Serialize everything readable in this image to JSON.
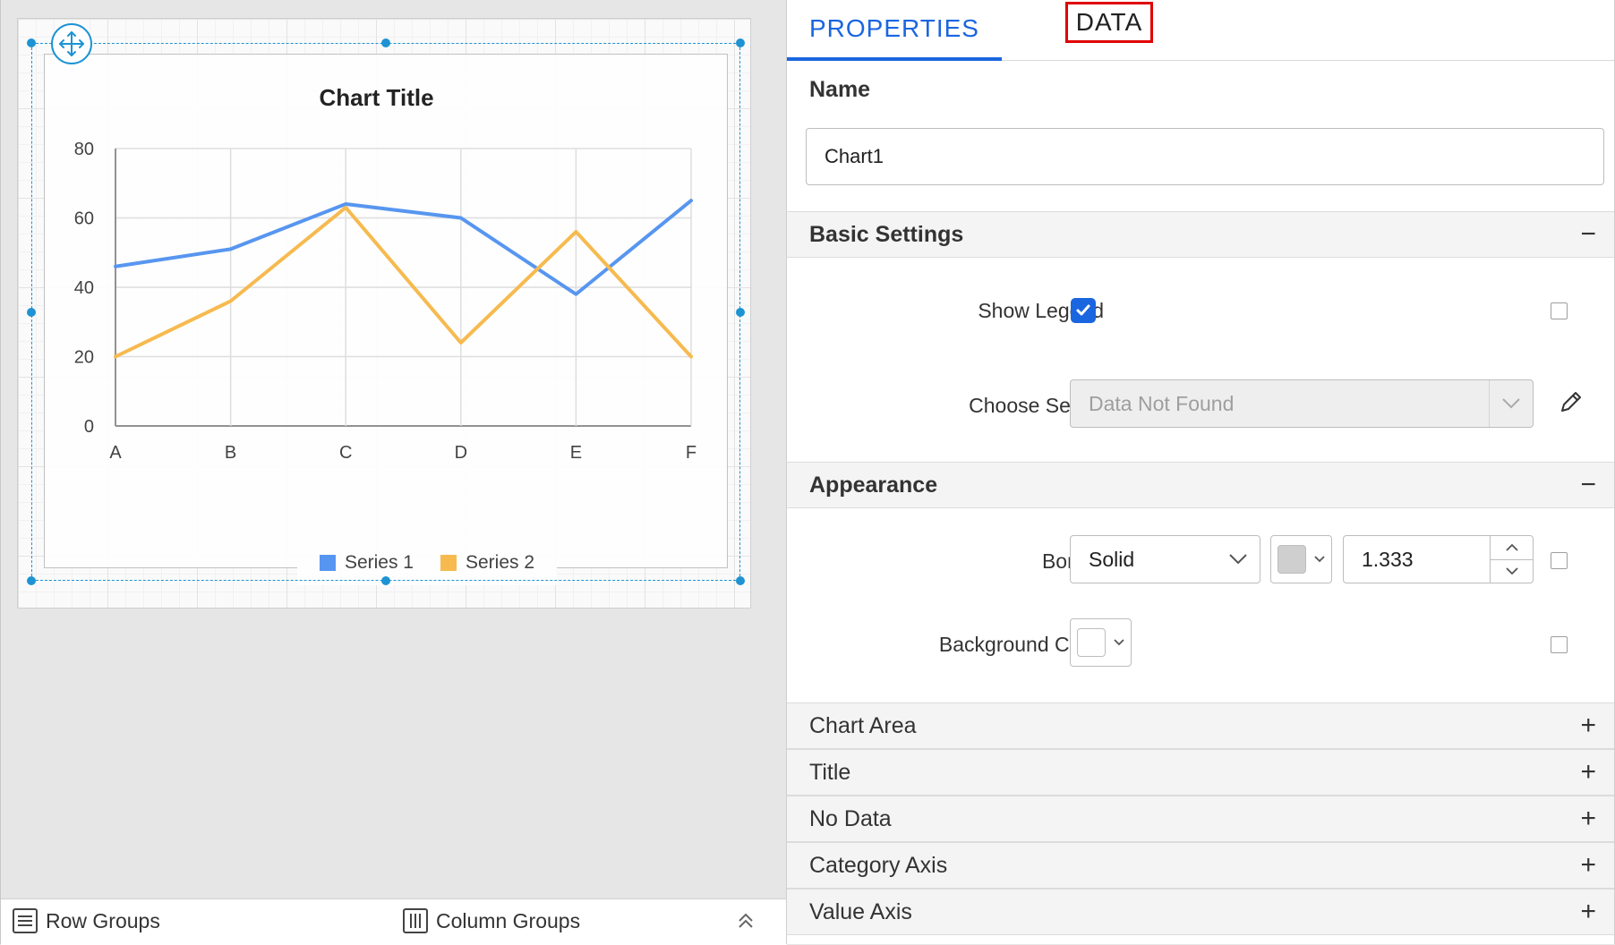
{
  "tabs": {
    "properties": "PROPERTIES",
    "data": "DATA"
  },
  "name": {
    "label": "Name",
    "value": "Chart1"
  },
  "basic_settings": {
    "header": "Basic Settings",
    "toggle": "−",
    "show_legend_label": "Show Legend",
    "show_legend_checked": true,
    "choose_series_label": "Choose Series",
    "choose_series_value": "Data Not Found"
  },
  "appearance": {
    "header": "Appearance",
    "toggle": "−",
    "border_label": "Border",
    "border_style": "Solid",
    "border_color": "#cfcfcf",
    "border_width": "1.333",
    "background_color_label": "Background Color",
    "background_color": "#ffffff"
  },
  "collapsed_sections": [
    {
      "label": "Chart Area",
      "toggle": "+"
    },
    {
      "label": "Title",
      "toggle": "+"
    },
    {
      "label": "No Data",
      "toggle": "+"
    },
    {
      "label": "Category Axis",
      "toggle": "+"
    },
    {
      "label": "Value Axis",
      "toggle": "+"
    }
  ],
  "bottom_bar": {
    "row_groups": "Row Groups",
    "column_groups": "Column Groups"
  },
  "colors": {
    "accent": "#1a66e0",
    "selection": "#1e93d3",
    "highlight": "#e00000"
  },
  "chart_data": {
    "type": "line",
    "title": "Chart Title",
    "categories": [
      "A",
      "B",
      "C",
      "D",
      "E",
      "F"
    ],
    "ylim": [
      0,
      80
    ],
    "yticks": [
      "0",
      "20",
      "40",
      "60",
      "80"
    ],
    "grid": true,
    "legend_position": "bottom",
    "series": [
      {
        "name": "Series 1",
        "color": "#4a8ef0",
        "values": [
          46,
          51,
          64,
          60,
          38,
          65
        ]
      },
      {
        "name": "Series 2",
        "color": "#f7b541",
        "values": [
          20,
          36,
          63,
          24,
          56,
          20
        ]
      }
    ]
  }
}
